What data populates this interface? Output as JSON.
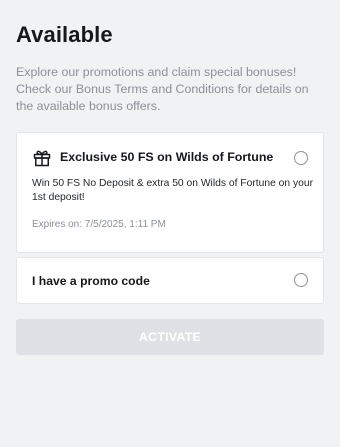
{
  "page": {
    "title": "Available",
    "intro": "Explore our promotions and claim special bonuses! Check our Bonus Terms and Conditions for details on the available bonus offers."
  },
  "bonus": {
    "icon": "gift-icon",
    "title": "Exclusive 50 FS on Wilds of Fortune",
    "description": "Win 50 FS No Deposit & extra 50 on Wilds of Fortune on your 1st deposit!",
    "expiry": "Expires on: 7/5/2025, 1:11 PM",
    "selected": false
  },
  "promo": {
    "label": "I have a promo code",
    "selected": false
  },
  "actions": {
    "activate_label": "ACTIVATE",
    "activate_enabled": false
  },
  "colors": {
    "background": "#f1f2f4",
    "card": "#ffffff",
    "text_primary": "#16181c",
    "text_muted": "#8b9098",
    "button_disabled": "#dee1e6"
  }
}
